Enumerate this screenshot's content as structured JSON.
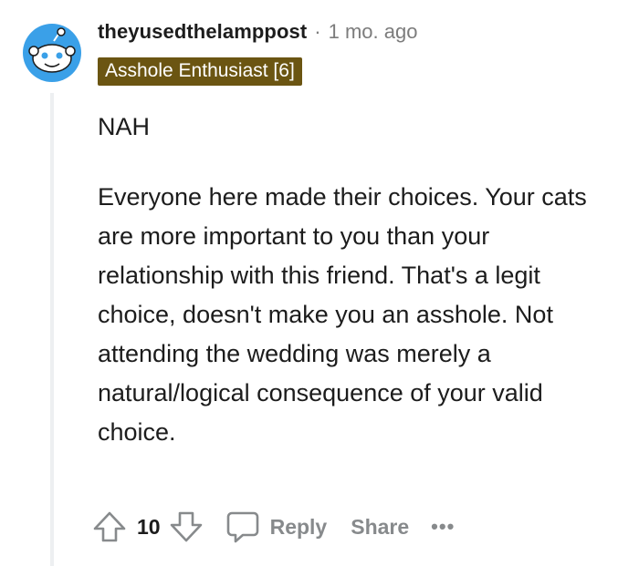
{
  "comment": {
    "username": "theyusedthelamppost",
    "separator": "·",
    "timestamp": "1 mo. ago",
    "flair": "Asshole Enthusiast [6]",
    "flair_color": "#6b5512",
    "paragraphs": [
      "NAH",
      "Everyone here made their choices. Your cats are more important to you than your relationship with this friend. That's a legit choice, doesn't make you an asshole. Not attending the wedding was merely a natural/logical consequence of your valid choice."
    ]
  },
  "actions": {
    "upvote_icon": "upvote-arrow-icon",
    "vote_count": "10",
    "downvote_icon": "downvote-arrow-icon",
    "reply_icon": "speech-bubble-icon",
    "reply_label": "Reply",
    "share_label": "Share",
    "more_label": "•••"
  },
  "avatar": {
    "icon": "snoo-avatar-icon",
    "color": "#3aa0e8"
  }
}
